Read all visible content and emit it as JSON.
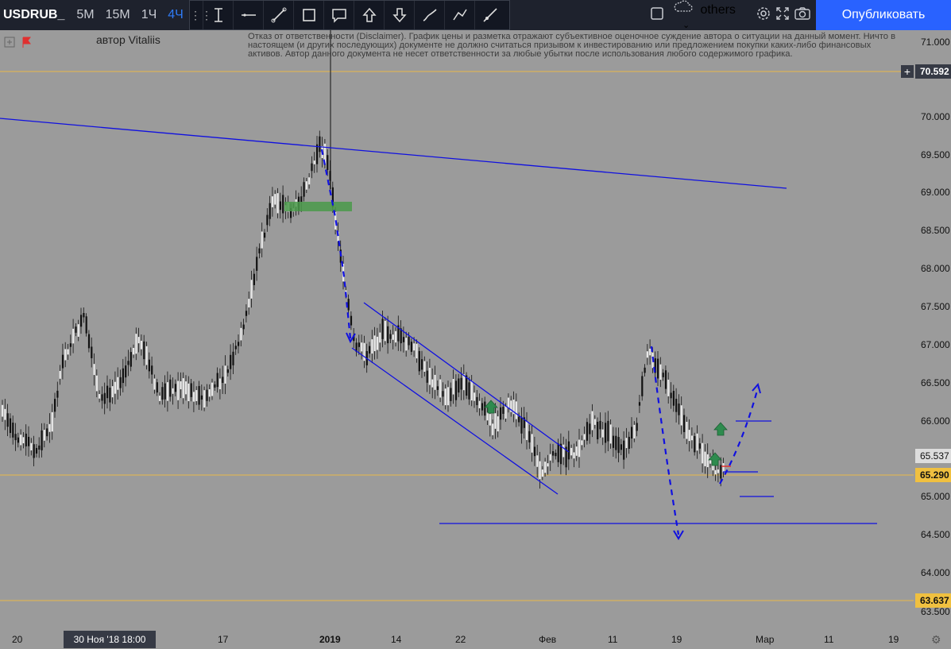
{
  "toolbar": {
    "symbol": "USDRUB_",
    "timeframes": [
      {
        "label": "5M",
        "active": false
      },
      {
        "label": "15M",
        "active": false
      },
      {
        "label": "1Ч",
        "active": false
      },
      {
        "label": "4Ч",
        "active": true
      }
    ],
    "drawing_tools": [
      "cursor-tool-icon",
      "horizontal-line-icon",
      "trend-line-icon",
      "rectangle-icon",
      "callout-icon",
      "arrow-up-icon",
      "arrow-down-icon",
      "brush-icon",
      "polyline-icon",
      "ray-icon"
    ],
    "layout_name": "others",
    "publish_label": "Опубликовать",
    "accent_color": "#2962ff"
  },
  "chart": {
    "author": "автор Vitaliis",
    "disclaimer": "Отказ от ответственности (Disclaimer). График цены и разметка отражают субъективное оценочное суждение автора о ситуации на данный момент. Ничто в настоящем (и других последующих) документе не должно считаться призывом к инвестированию или предложением покупки каких-либо финансовых активов. Автор данного документа не несет ответственности за любые убытки после использования любого содержимого графика.",
    "price_ticks": [
      "71.000",
      "70.000",
      "69.500",
      "69.000",
      "68.500",
      "68.000",
      "67.500",
      "67.000",
      "66.500",
      "66.000",
      "65.000",
      "64.500",
      "64.000",
      "63.500"
    ],
    "price_labels": [
      {
        "value": "70.592",
        "style": "line"
      },
      {
        "value": "65.537",
        "style": "current"
      },
      {
        "value": "65.290",
        "style": "line"
      },
      {
        "value": "63.637",
        "style": "line"
      }
    ],
    "time_ticks": [
      "20",
      "17",
      "2019",
      "14",
      "22",
      "Фев",
      "11",
      "19",
      "Мар",
      "11",
      "19"
    ],
    "cursor_time": "30 Ноя '18   18:00",
    "colors": {
      "background": "#9b9b9b",
      "drawing_line": "#1010e0",
      "level_line": "#f0c040",
      "zone": "#4a9a4a",
      "arrow_marker": "#2e8b4e"
    }
  }
}
